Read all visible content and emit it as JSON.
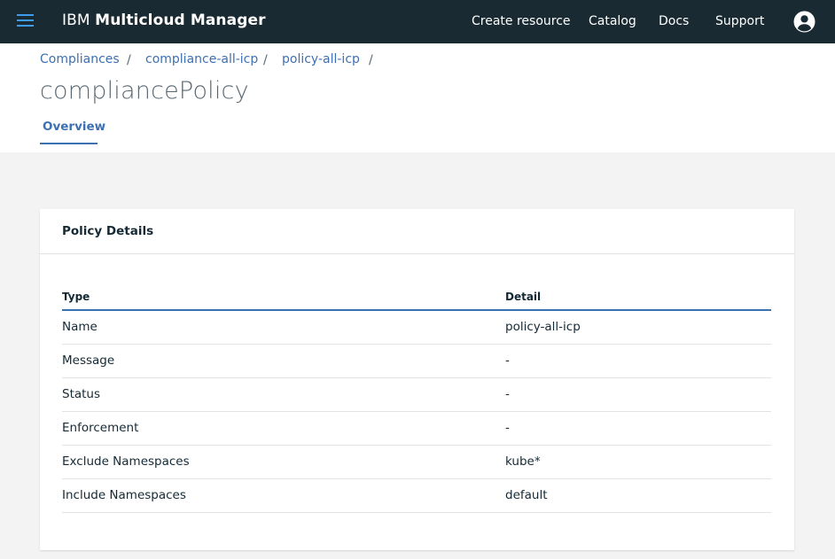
{
  "topbar": {
    "brand_prefix": "IBM",
    "brand_name": "Multicloud Manager",
    "nav": {
      "create": "Create resource",
      "catalog": "Catalog",
      "docs": "Docs",
      "support": "Support"
    },
    "accent": "#3d9bf0"
  },
  "breadcrumb": {
    "items": [
      "Compliances",
      "compliance-all-icp",
      "policy-all-icp"
    ],
    "separator": "/"
  },
  "page": {
    "title": "compliancePolicy",
    "tabs": [
      "Overview"
    ]
  },
  "card": {
    "title": "Policy Details",
    "columns": [
      "Type",
      "Detail"
    ],
    "rows": [
      [
        "Name",
        "policy-all-icp"
      ],
      [
        "Message",
        "-"
      ],
      [
        "Status",
        "-"
      ],
      [
        "Enforcement",
        "-"
      ],
      [
        "Exclude Namespaces",
        "kube*"
      ],
      [
        "Include Namespaces",
        "default"
      ]
    ]
  }
}
